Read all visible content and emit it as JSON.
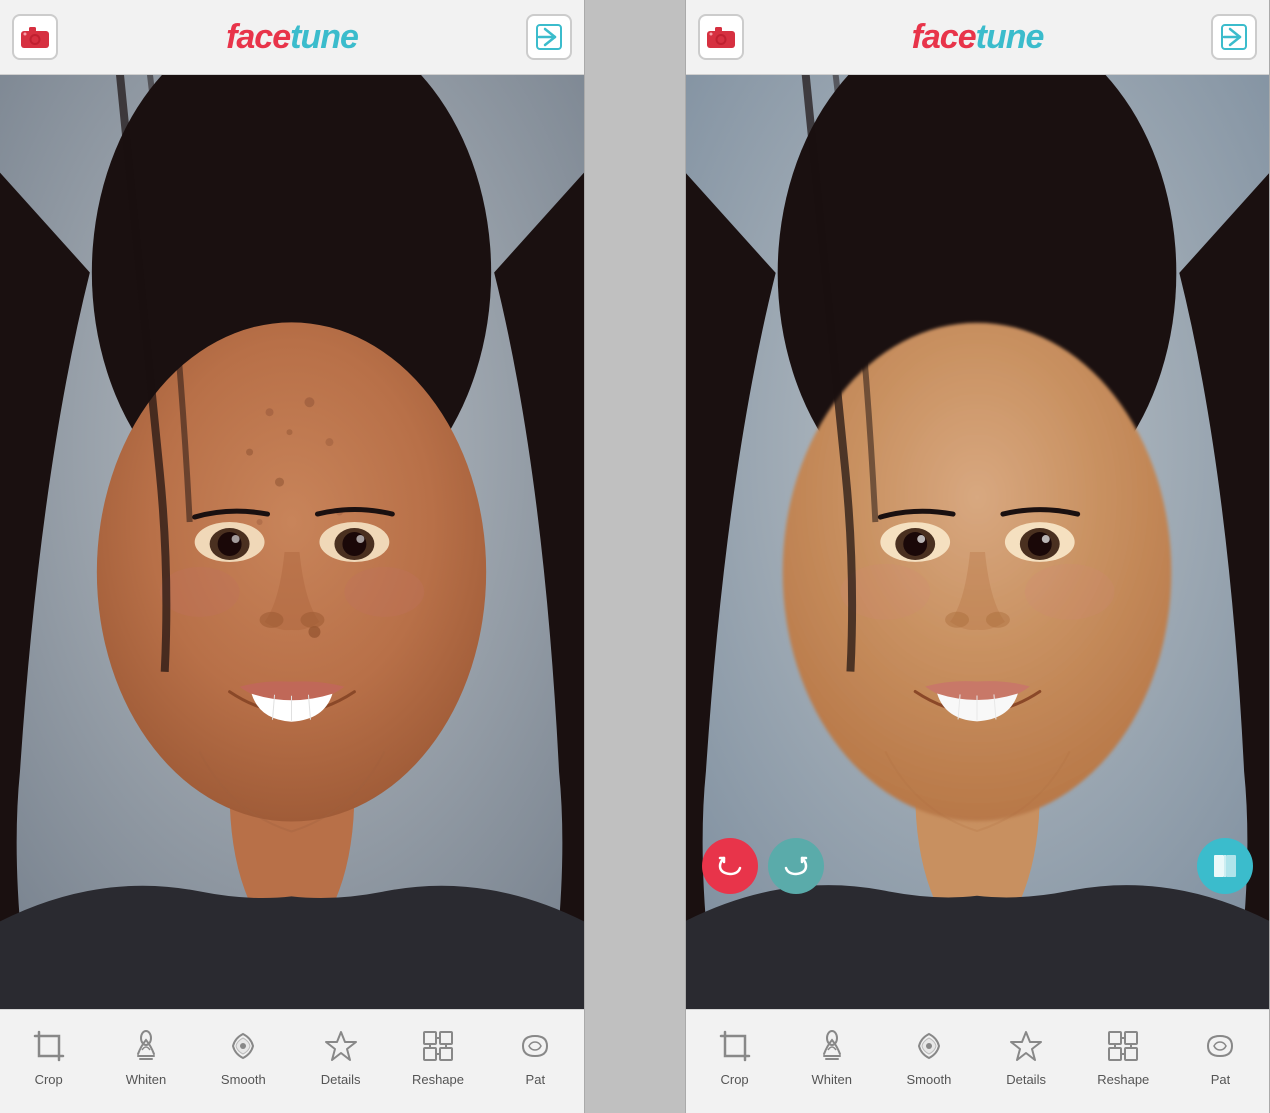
{
  "app": {
    "name_prefix": "face",
    "name_suffix": "tune",
    "logo_text": "facetune"
  },
  "panels": [
    {
      "id": "before",
      "has_action_buttons": false
    },
    {
      "id": "after",
      "has_action_buttons": true
    }
  ],
  "toolbar": {
    "items": [
      {
        "id": "crop",
        "label": "Crop",
        "icon": "crop-icon"
      },
      {
        "id": "whiten",
        "label": "Whiten",
        "icon": "whiten-icon"
      },
      {
        "id": "smooth",
        "label": "Smooth",
        "icon": "smooth-icon"
      },
      {
        "id": "details",
        "label": "Details",
        "icon": "details-icon"
      },
      {
        "id": "reshape",
        "label": "Reshape",
        "icon": "reshape-icon"
      },
      {
        "id": "patch",
        "label": "Pat",
        "icon": "patch-icon"
      }
    ]
  },
  "action_buttons": {
    "undo_label": "undo",
    "redo_label": "redo",
    "compare_label": "compare",
    "undo_color": "#e8344a",
    "redo_color": "#5aabaa",
    "compare_color": "#3bbccc"
  },
  "colors": {
    "logo_red": "#e8344a",
    "logo_cyan": "#3bbccc",
    "header_bg": "#f2f2f2",
    "toolbar_bg": "#f2f2f2",
    "divider": "#c0c0c0"
  }
}
